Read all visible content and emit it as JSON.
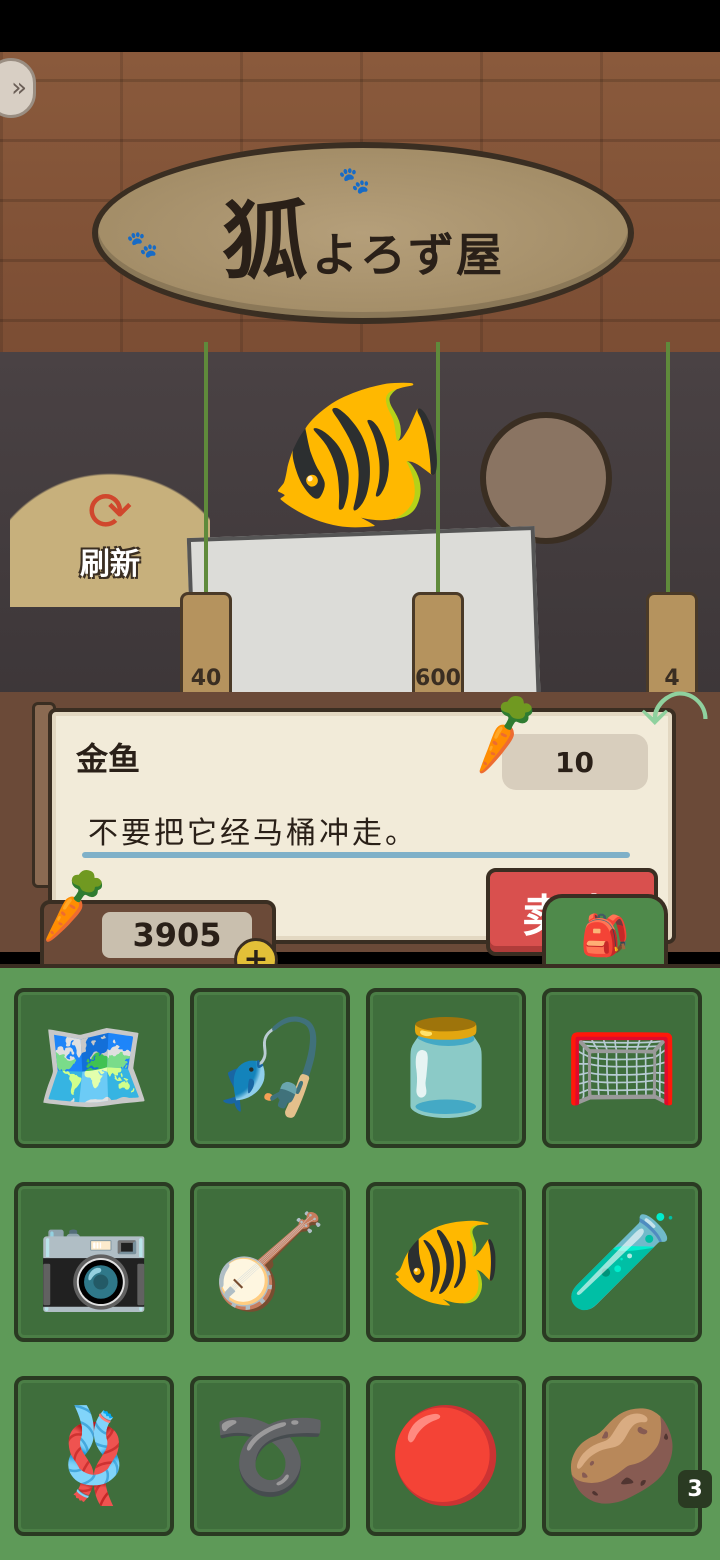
{
  "shop": {
    "sign_title": "狐",
    "sign_subtitle": "よろず屋",
    "refresh_label": "刷新",
    "tags": [
      "40",
      "600",
      "4"
    ]
  },
  "dialog": {
    "item_name": "金鱼",
    "price": "10",
    "description": "不要把它经马桶冲走。",
    "sell_label": "卖出"
  },
  "currency": {
    "amount": "3905",
    "plus_label": "+"
  },
  "inventory": {
    "items": [
      {
        "name": "poster-map",
        "icon": "🗺️"
      },
      {
        "name": "fishing-rod",
        "icon": "🎣"
      },
      {
        "name": "fruit-jar",
        "icon": "🫙"
      },
      {
        "name": "bug-net",
        "icon": "🥅"
      },
      {
        "name": "instant-camera",
        "icon": "📷"
      },
      {
        "name": "ukulele",
        "icon": "🪕"
      },
      {
        "name": "goldfish",
        "icon": "🐠"
      },
      {
        "name": "test-tube",
        "icon": "🧪"
      },
      {
        "name": "rope-tassel",
        "icon": "🪢"
      },
      {
        "name": "jump-rope",
        "icon": "➰"
      },
      {
        "name": "kendama",
        "icon": "🔴"
      },
      {
        "name": "chips-bag",
        "icon": "🥔"
      }
    ],
    "page": "3"
  }
}
